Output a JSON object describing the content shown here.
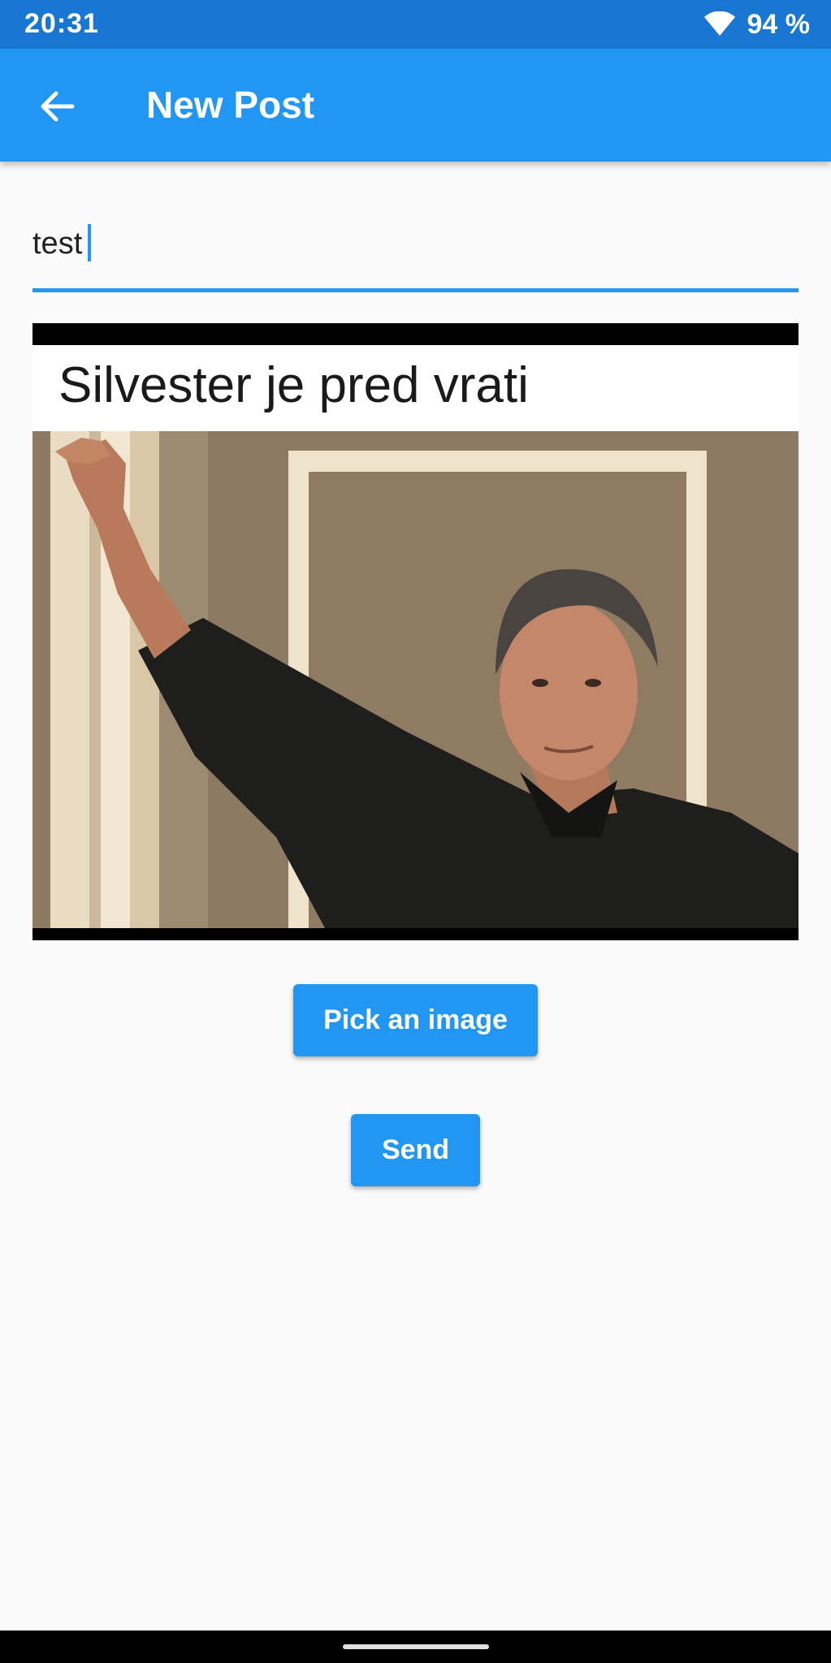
{
  "status_bar": {
    "time": "20:31",
    "battery": "94 %",
    "wifi_icon": "wifi-icon"
  },
  "app_bar": {
    "title": "New Post",
    "back_icon": "arrow-back-icon"
  },
  "post": {
    "text": "test"
  },
  "image": {
    "caption": "Silvester je pred vrati"
  },
  "buttons": {
    "pick_image": "Pick an image",
    "send": "Send"
  },
  "colors": {
    "primary": "#2196f3",
    "status_bar": "#1976d2",
    "background": "#fafafa"
  }
}
